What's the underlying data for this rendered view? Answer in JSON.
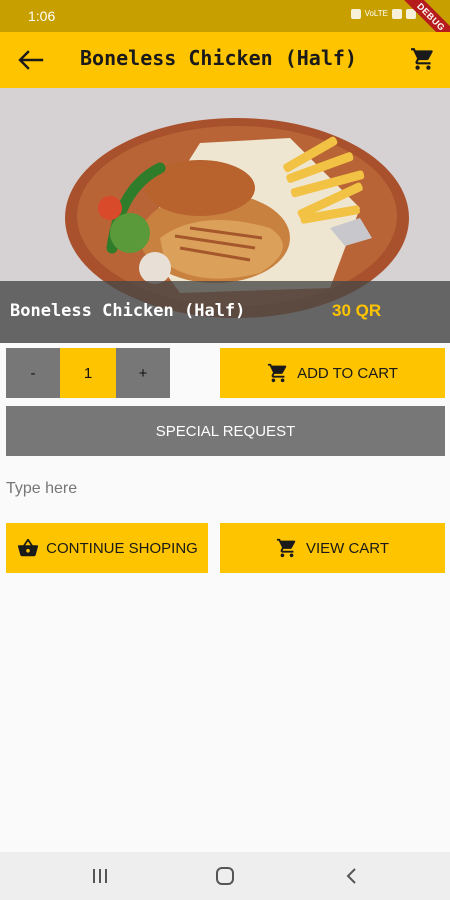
{
  "status_bar": {
    "time": "1:06",
    "network_label": "VoLTE",
    "debug_label": "DEBUG"
  },
  "app_bar": {
    "title": "Boneless Chicken (Half)",
    "back_icon": "arrow-back-icon",
    "cart_icon": "shopping-cart-icon"
  },
  "hero": {
    "image_icon": "grilled-chicken-plate-image",
    "name": "Boneless Chicken (Half)",
    "price": "30 QR"
  },
  "quantity": {
    "minus_label": "-",
    "value": "1",
    "plus_label": "+"
  },
  "actions": {
    "add_to_cart_label": "ADD TO CART",
    "special_request_label": "SPECIAL REQUEST",
    "request_placeholder": "Type here",
    "request_value": "",
    "continue_shopping_label": "CONTINUE SHOPING",
    "view_cart_label": "VIEW CART"
  },
  "colors": {
    "accent": "#ffc400",
    "status_bar": "#c7a000",
    "secondary": "#777777",
    "price": "#ffc400"
  },
  "nav_bar": {
    "recents_icon": "recents-icon",
    "home_icon": "home-icon",
    "back_icon": "nav-back-icon"
  }
}
